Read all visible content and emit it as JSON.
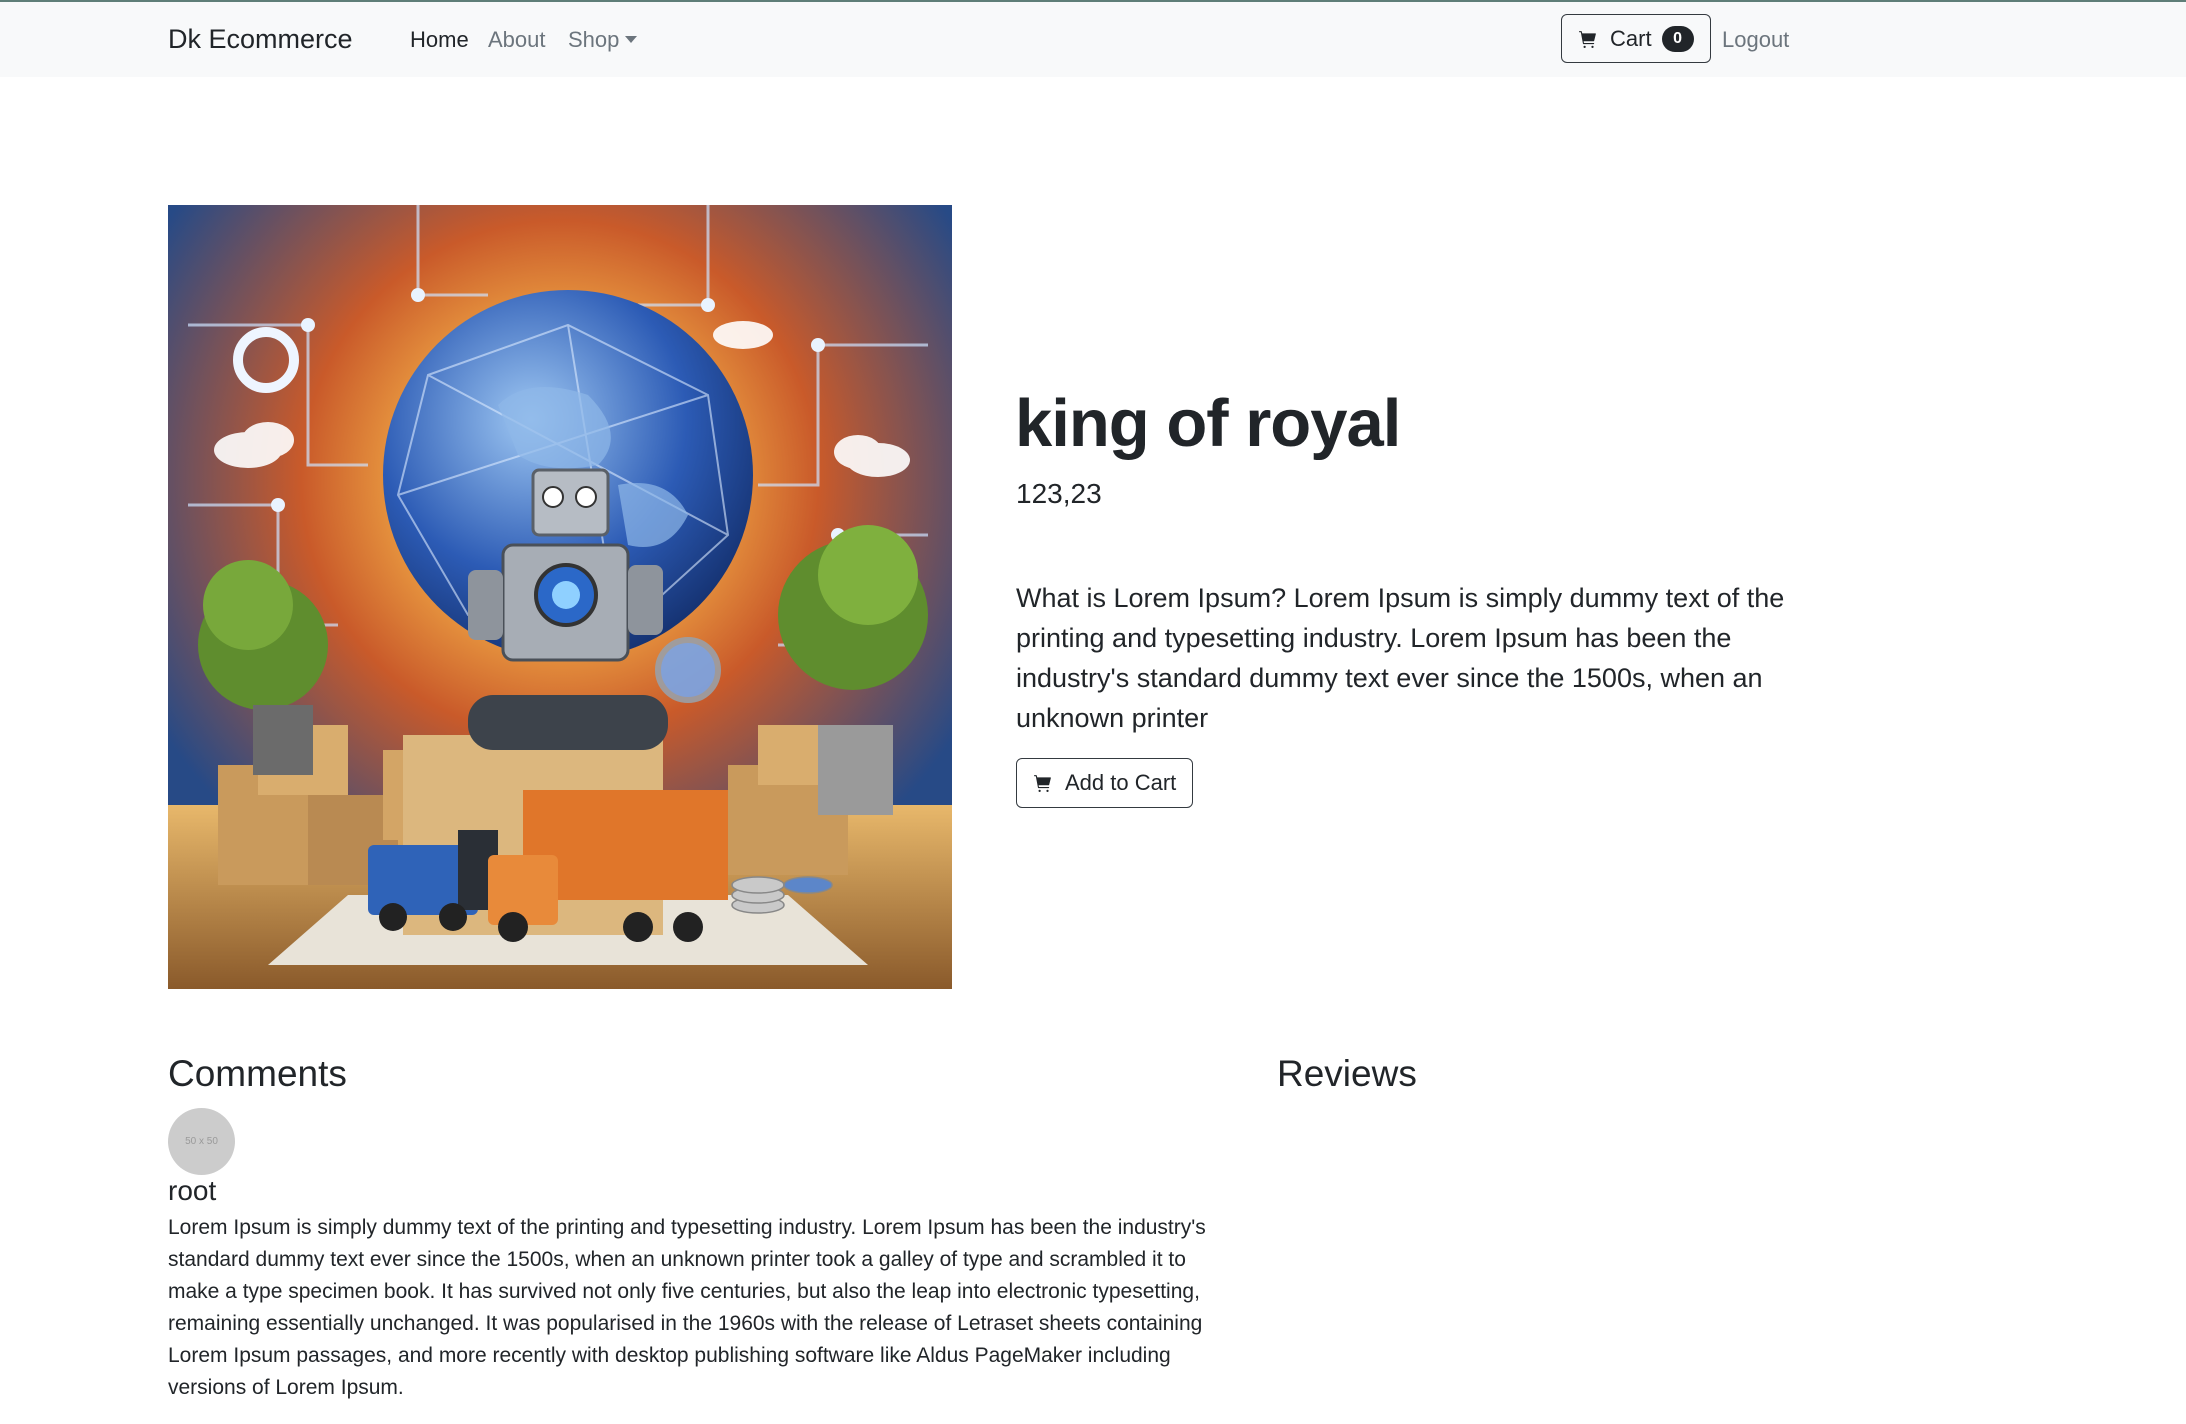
{
  "navbar": {
    "brand": "Dk Ecommerce",
    "links": [
      {
        "label": "Home",
        "active": true
      },
      {
        "label": "About",
        "active": false
      },
      {
        "label": "Shop",
        "active": false,
        "dropdown": true
      }
    ],
    "cart": {
      "label": "Cart",
      "count": "0",
      "icon": "cart-icon"
    },
    "logout": "Logout"
  },
  "product": {
    "title": "king of royal",
    "price": "123,23",
    "description": "What is Lorem Ipsum? Lorem Ipsum is simply dummy text of the printing and typesetting industry. Lorem Ipsum has been the industry's standard dummy text ever since the 1500s, when an unknown printer",
    "add_to_cart": "Add to Cart"
  },
  "comments": {
    "title": "Comments",
    "items": [
      {
        "avatar_text": "50 x 50",
        "author": "root",
        "body": "Lorem Ipsum is simply dummy text of the printing and typesetting industry. Lorem Ipsum has been the industry's standard dummy text ever since the 1500s, when an unknown printer took a galley of type and scrambled it to make a type specimen book. It has survived not only five centuries, but also the leap into electronic typesetting, remaining essentially unchanged. It was popularised in the 1960s with the release of Letraset sheets containing Lorem Ipsum passages, and more recently with desktop publishing software like Aldus PageMaker including versions of Lorem Ipsum."
      }
    ]
  },
  "reviews": {
    "title": "Reviews"
  },
  "colors": {
    "navbar_bg": "#f8f9fa",
    "text": "#212529",
    "muted": "#6c757d",
    "badge": "#212529"
  }
}
